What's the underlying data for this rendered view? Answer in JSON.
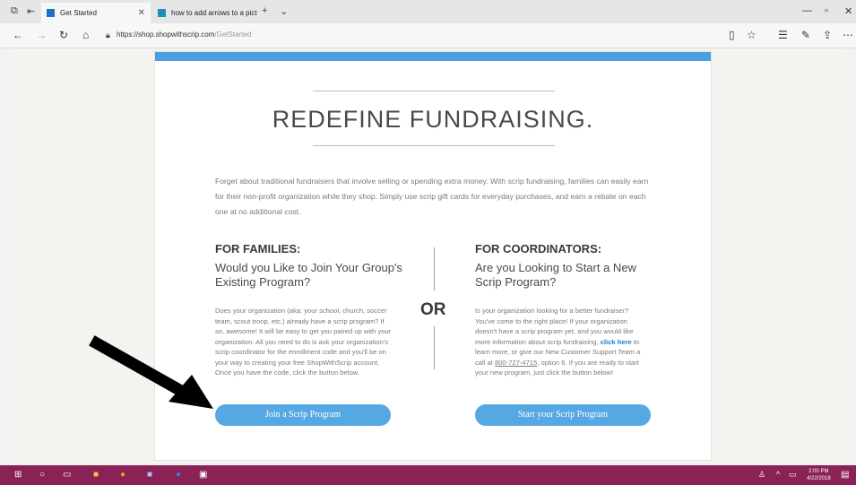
{
  "browser": {
    "tabs": [
      {
        "label": "Get Started",
        "active": true
      },
      {
        "label": "how to add arrows to a pict",
        "active": false
      }
    ],
    "url_host": "https://shop.shopwithscrip.com",
    "url_path": "/GetStarted"
  },
  "page": {
    "headline": "REDEFINE FUNDRAISING.",
    "intro": "Forget about traditional fundraisers that involve selling or spending extra money. With scrip fundraising, families can easily earn for their non-profit organization while they shop. Simply use scrip gift cards for everyday purchases, and earn a rebate on each one at no additional cost.",
    "or_label": "OR",
    "families": {
      "heading": "FOR FAMILIES:",
      "subheading": "Would you Like to Join Your Group's Existing Program?",
      "body": "Does your organization (aka: your school, church, soccer team, scout troop, etc.) already have a scrip program? If so, awesome! It will be easy to get you paired up with your organization. All you need to do is ask your organization's scrip coordinator for the enrollment code and you'll be on your way to creating your free ShopWithScrip account. Once you have the code, click the button below.",
      "button": "Join a Scrip Program"
    },
    "coordinators": {
      "heading": "FOR COORDINATORS:",
      "subheading": "Are you Looking to Start a New Scrip Program?",
      "body_1": "Is your organization looking for a better fundraiser? You've come to the right place! If your organization doesn't have a scrip program yet, and you would like more information about scrip fundraising, ",
      "link": "click here",
      "body_2": " to learn more, or give our New Customer Support Team a call at ",
      "phone": "800-727-4715",
      "body_3": ", option 6. If you are ready to start your new program, just click the button below!",
      "button": "Start your Scrip Program"
    }
  },
  "taskbar": {
    "time": "2:00 PM",
    "date": "4/22/2018"
  },
  "colors": {
    "accent": "#4a9fe0",
    "button": "#56a8e2",
    "taskbar": "#8a2257",
    "link": "#1a7fd0"
  }
}
